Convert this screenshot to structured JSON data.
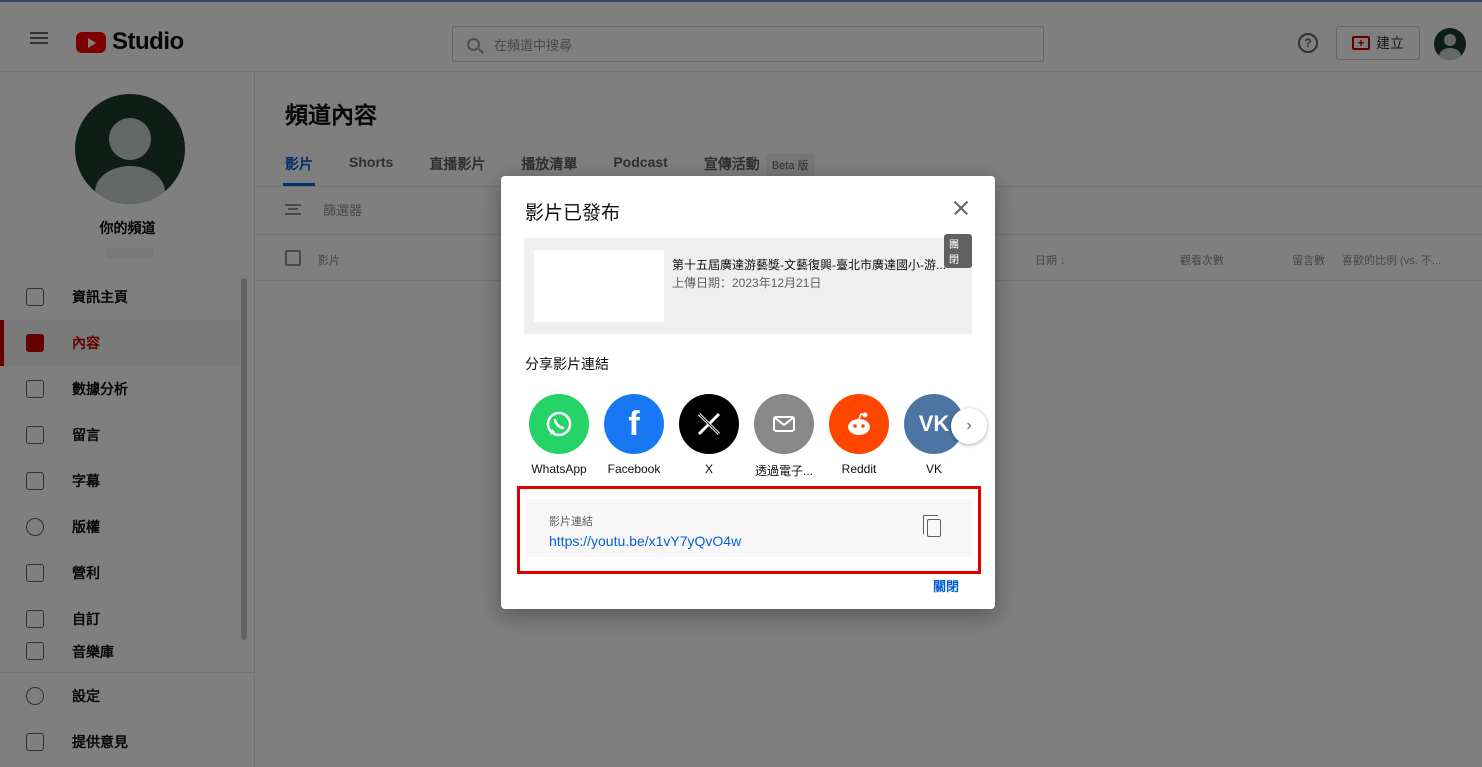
{
  "header": {
    "logo_text": "Studio",
    "search_placeholder": "在頻道中搜尋",
    "help_glyph": "?",
    "create_label": "建立"
  },
  "sidebar": {
    "channel_label": "你的頻道",
    "items": [
      {
        "label": "資訊主頁",
        "icon": "dashboard-icon"
      },
      {
        "label": "內容",
        "icon": "content-icon",
        "active": true
      },
      {
        "label": "數據分析",
        "icon": "analytics-icon"
      },
      {
        "label": "留言",
        "icon": "comments-icon"
      },
      {
        "label": "字幕",
        "icon": "subtitles-icon"
      },
      {
        "label": "版權",
        "icon": "copyright-icon"
      },
      {
        "label": "營利",
        "icon": "dollar-icon"
      },
      {
        "label": "自訂",
        "icon": "magic-wand-icon"
      },
      {
        "label": "音樂庫",
        "icon": "audio-library-icon"
      }
    ],
    "bottom_items": [
      {
        "label": "設定",
        "icon": "gear-icon"
      },
      {
        "label": "提供意見",
        "icon": "feedback-icon"
      }
    ]
  },
  "main": {
    "title": "頻道內容",
    "tabs": [
      "影片",
      "Shorts",
      "直播影片",
      "播放清單",
      "Podcast",
      "宣傳活動"
    ],
    "beta_badge": "Beta 版",
    "filter_label": "篩選器",
    "columns": {
      "video": "影片",
      "date": "日期 ↓",
      "views": "觀看次數",
      "comments": "留言數",
      "likes": "喜歡的比例 (vs. 不..."
    }
  },
  "dialog": {
    "title": "影片已發布",
    "visibility_badge": "團閉",
    "video_title": "第十五屆廣達游藝獎-文藝復興-臺北市廣達國小-游...",
    "upload_date": "上傳日期：2023年12月21日",
    "share_label": "分享影片連結",
    "share_targets": [
      {
        "name": "WhatsApp",
        "color": "#25d366",
        "icon": "whatsapp-icon"
      },
      {
        "name": "Facebook",
        "color": "#1877f2",
        "icon": "facebook-icon"
      },
      {
        "name": "X",
        "color": "#000000",
        "icon": "x-icon"
      },
      {
        "name": "透過電子...",
        "color": "#888888",
        "icon": "email-icon"
      },
      {
        "name": "Reddit",
        "color": "#ff4500",
        "icon": "reddit-icon"
      },
      {
        "name": "VK",
        "color": "#4c75a3",
        "icon": "vk-icon"
      }
    ],
    "link_label": "影片連結",
    "link_url": "https://youtu.be/x1vY7yQvO4w",
    "close_label": "關閉"
  },
  "colors": {
    "brand_red": "#ff0000",
    "link_blue": "#065fd4",
    "highlight_box": "#e00000"
  }
}
